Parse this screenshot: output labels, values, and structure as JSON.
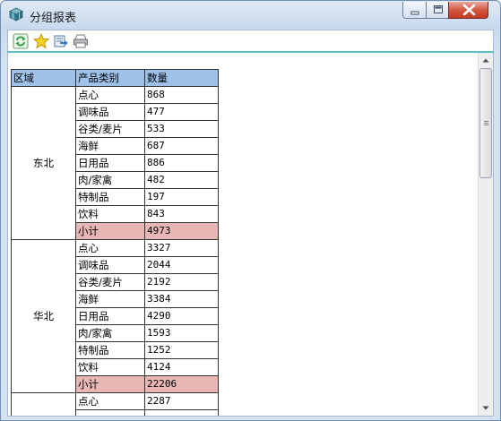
{
  "window": {
    "title": "分组报表",
    "title_icon": "cube-app-icon",
    "controls": [
      "minimize-icon",
      "maximize-icon",
      "close-icon"
    ]
  },
  "toolbar": {
    "buttons": [
      {
        "icon": "refresh-icon",
        "color": "#2e9a3a"
      },
      {
        "icon": "star-icon",
        "color": "#f2c200"
      },
      {
        "icon": "export-icon",
        "color": "#3b78c9"
      },
      {
        "icon": "print-icon",
        "color": "#8a8a8a"
      }
    ]
  },
  "report": {
    "headers": [
      "区域",
      "产品类别",
      "数量"
    ],
    "header_color": "#9ec1ea",
    "subtotal_color": "#e8b7b5",
    "groups": [
      {
        "region": "东北",
        "rows": [
          {
            "category": "点心",
            "qty": "868"
          },
          {
            "category": "调味品",
            "qty": "477"
          },
          {
            "category": "谷类/麦片",
            "qty": "533"
          },
          {
            "category": "海鲜",
            "qty": "687"
          },
          {
            "category": "日用品",
            "qty": "886"
          },
          {
            "category": "肉/家禽",
            "qty": "482"
          },
          {
            "category": "特制品",
            "qty": "197"
          },
          {
            "category": "饮料",
            "qty": "843"
          }
        ],
        "subtotal": {
          "label": "小计",
          "qty": "4973"
        }
      },
      {
        "region": "华北",
        "rows": [
          {
            "category": "点心",
            "qty": "3327"
          },
          {
            "category": "调味品",
            "qty": "2044"
          },
          {
            "category": "谷类/麦片",
            "qty": "2192"
          },
          {
            "category": "海鲜",
            "qty": "3384"
          },
          {
            "category": "日用品",
            "qty": "4290"
          },
          {
            "category": "肉/家禽",
            "qty": "1593"
          },
          {
            "category": "特制品",
            "qty": "1252"
          },
          {
            "category": "饮料",
            "qty": "4124"
          }
        ],
        "subtotal": {
          "label": "小计",
          "qty": "22206"
        }
      },
      {
        "region": "",
        "rows": [
          {
            "category": "点心",
            "qty": "2287"
          }
        ]
      }
    ]
  }
}
